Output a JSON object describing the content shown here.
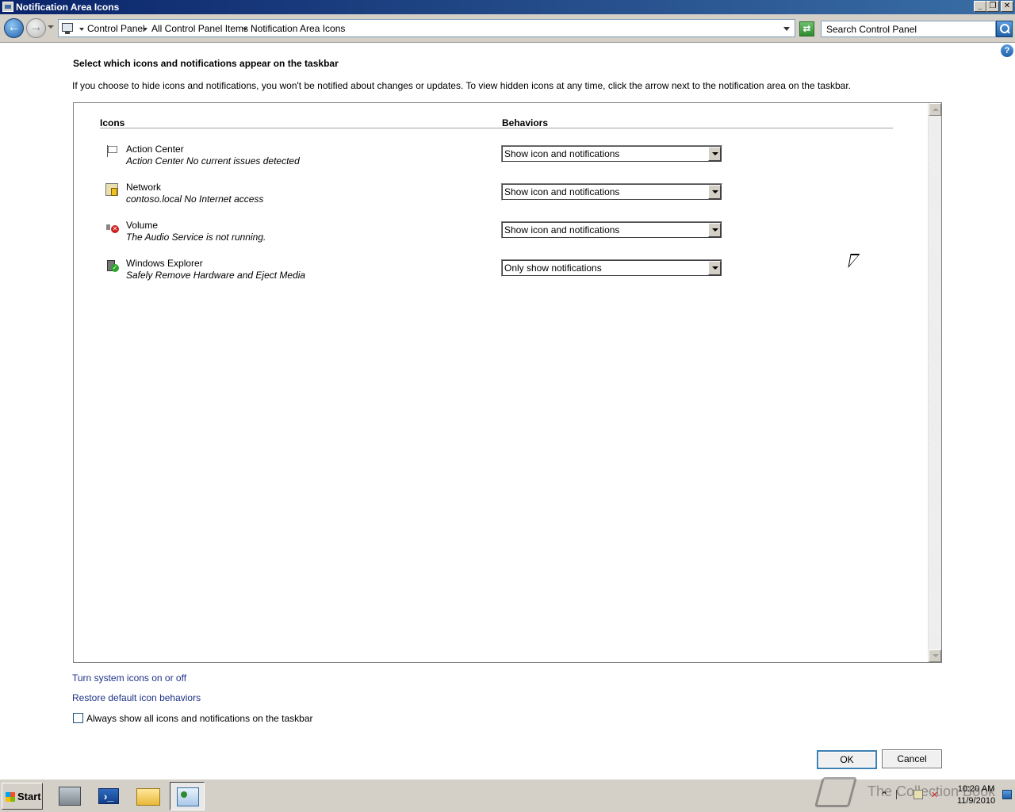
{
  "window": {
    "title": "Notification Area Icons"
  },
  "addressbar": {
    "breadcrumbs": [
      "Control Panel",
      "All Control Panel Items",
      "Notification Area Icons"
    ],
    "search_placeholder": "Search Control Panel"
  },
  "content": {
    "heading": "Select which icons and notifications appear on the taskbar",
    "description": "If you choose to hide icons and notifications, you won't be notified about changes or updates. To view hidden icons at any time, click the arrow next to the notification area on the taskbar.",
    "columns": {
      "icons": "Icons",
      "behaviors": "Behaviors"
    },
    "rows": [
      {
        "name": "Action Center",
        "subtitle": "Action Center  No current issues detected",
        "behavior": "Show icon and notifications",
        "icon": "flag-icon"
      },
      {
        "name": "Network",
        "subtitle": "contoso.local No Internet access",
        "behavior": "Show icon and notifications",
        "icon": "network-icon"
      },
      {
        "name": "Volume",
        "subtitle": "The Audio Service is not running.",
        "behavior": "Show icon and notifications",
        "icon": "volume-icon"
      },
      {
        "name": "Windows Explorer",
        "subtitle": "Safely Remove Hardware and Eject Media",
        "behavior": "Only show notifications",
        "icon": "usb-icon"
      }
    ],
    "links": {
      "system_icons": "Turn system icons on or off",
      "restore": "Restore default icon behaviors"
    },
    "always_show_label": "Always show all icons and notifications on the taskbar",
    "always_show_checked": false
  },
  "buttons": {
    "ok": "OK",
    "cancel": "Cancel"
  },
  "taskbar": {
    "start_label": "Start",
    "apps": [
      "server-manager-icon",
      "powershell-icon",
      "explorer-folder-icon",
      "control-panel-icon"
    ],
    "time": "10:20 AM",
    "date": "11/9/2010"
  },
  "watermark": "The Collection Book"
}
